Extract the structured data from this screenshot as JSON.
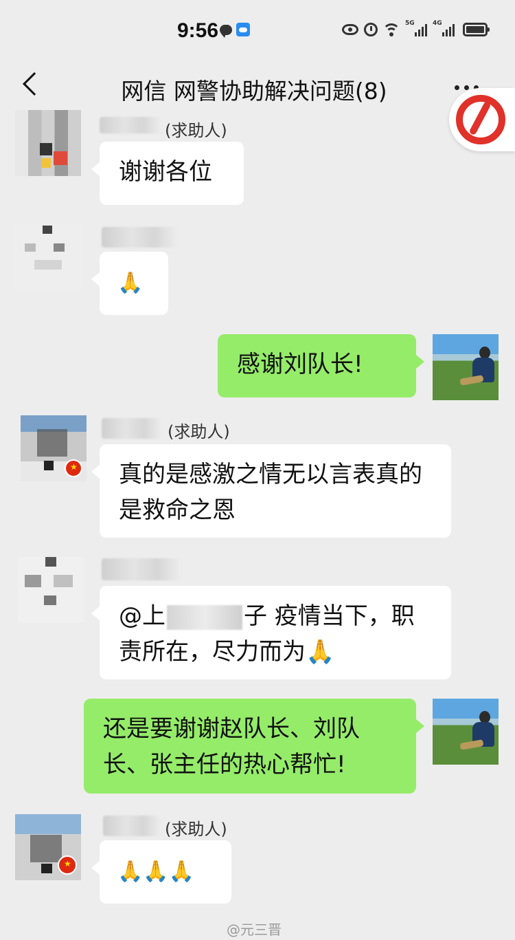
{
  "status_bar": {
    "time": "9:56",
    "signal1_label": "5G",
    "signal2_label": "4G"
  },
  "header": {
    "title": "网信 网警协助解决问题(8)"
  },
  "messages": [
    {
      "sender_tag": "(求助人)",
      "text": "谢谢各位"
    },
    {
      "sender_tag": "",
      "text": "🙏"
    },
    {
      "sender_tag": "",
      "text": "感谢刘队长!"
    },
    {
      "sender_tag": "(求助人)",
      "text": "真的是感激之情无以言表真的是救命之恩"
    },
    {
      "sender_tag": "",
      "text_prefix": "@上",
      "text_suffix": "子  疫情当下，职责所在，尽力而为🙏"
    },
    {
      "sender_tag": "",
      "text": "还是要谢谢赵队长、刘队长、张主任的热心帮忙!"
    },
    {
      "sender_tag": "(求助人)",
      "text": "🙏🙏🙏"
    }
  ],
  "watermark": "@元三晋",
  "colors": {
    "background": "#ededed",
    "my_bubble": "#95ec69",
    "other_bubble": "#ffffff"
  }
}
